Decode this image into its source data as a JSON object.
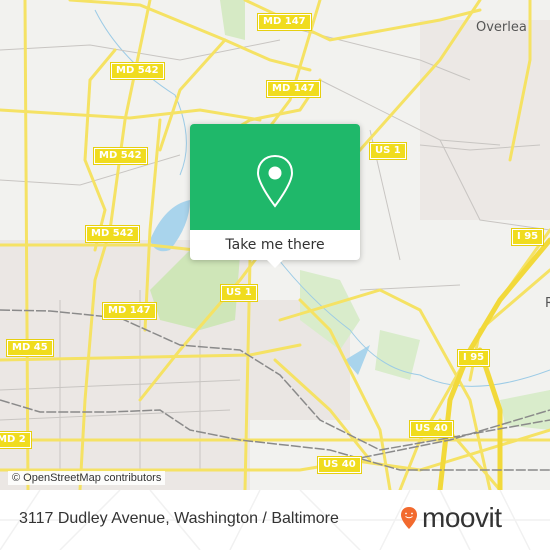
{
  "map": {
    "road_labels": [
      {
        "id": "md147-top",
        "text": "MD 147"
      },
      {
        "id": "md542-a",
        "text": "MD 542"
      },
      {
        "id": "md147-b",
        "text": "MD 147"
      },
      {
        "id": "md542-b",
        "text": "MD 542"
      },
      {
        "id": "us1-a",
        "text": "US 1"
      },
      {
        "id": "md542-c",
        "text": "MD 542"
      },
      {
        "id": "i95-a",
        "text": "I 95"
      },
      {
        "id": "us1-b",
        "text": "US 1"
      },
      {
        "id": "md147-c",
        "text": "MD 147"
      },
      {
        "id": "md45",
        "text": "MD 45"
      },
      {
        "id": "i95-b",
        "text": "I 95"
      },
      {
        "id": "md2",
        "text": "MD 2"
      },
      {
        "id": "us40-a",
        "text": "US 40"
      },
      {
        "id": "us40-b",
        "text": "US 40"
      }
    ],
    "place_labels": {
      "overlea": "Overlea",
      "edge": "R"
    },
    "attribution": "© OpenStreetMap contributors"
  },
  "popup": {
    "icon": "location-pin-icon",
    "button_label": "Take me there",
    "color": "#1fb86a"
  },
  "footer": {
    "address": "3117 Dudley Avenue, Washington / Baltimore",
    "brand": "moovit",
    "brand_color": "#f26a2e"
  }
}
